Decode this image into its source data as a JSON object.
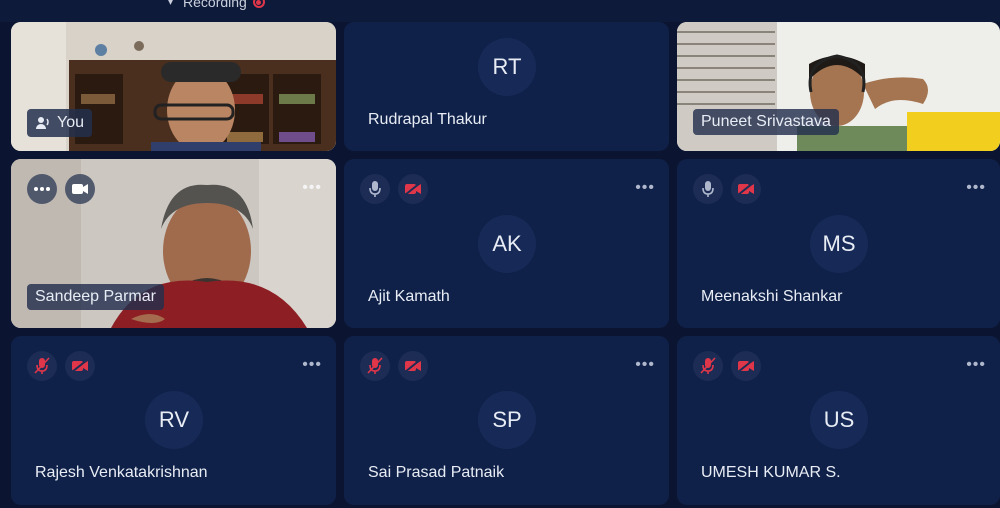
{
  "topbar": {
    "recording_label": "Recording"
  },
  "participants": [
    {
      "name": "You",
      "initials": ""
    },
    {
      "name": "Rudrapal Thakur",
      "initials": "RT"
    },
    {
      "name": "Puneet Srivastava",
      "initials": ""
    },
    {
      "name": "Sandeep Parmar",
      "initials": ""
    },
    {
      "name": "Ajit Kamath",
      "initials": "AK"
    },
    {
      "name": "Meenakshi Shankar",
      "initials": "MS"
    },
    {
      "name": "Rajesh Venkatakrishnan",
      "initials": "RV"
    },
    {
      "name": "Sai Prasad Patnaik",
      "initials": "SP"
    },
    {
      "name": "UMESH KUMAR S.",
      "initials": "US"
    }
  ],
  "icons": {
    "more": "more-options-icon",
    "mic_off": "mic-off-icon",
    "camera_off": "camera-off-icon",
    "speaker": "speaker-icon",
    "camera": "camera-icon"
  },
  "colors": {
    "background": "#0b1532",
    "tile": "#0f2148",
    "muted_red": "#e0364a"
  }
}
